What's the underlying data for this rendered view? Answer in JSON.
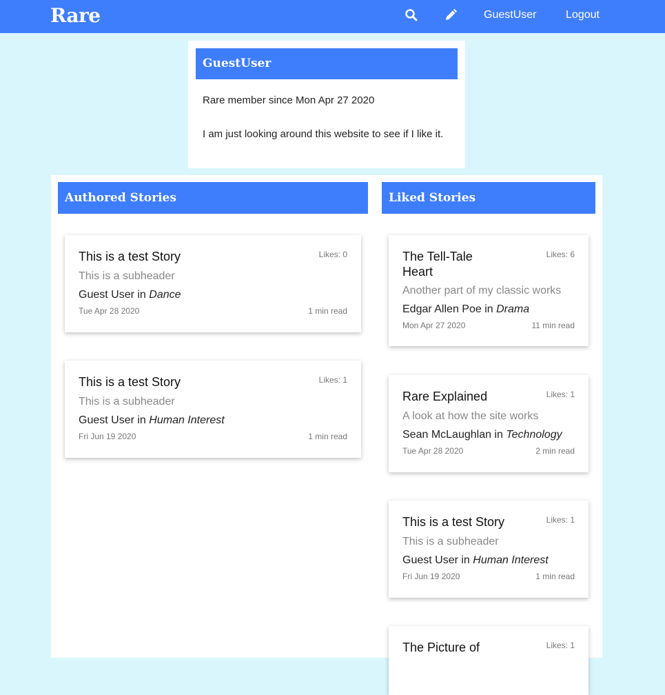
{
  "nav": {
    "brand": "Rare",
    "search_icon": "search-icon",
    "write_icon": "pencil-icon",
    "user_link": "GuestUser",
    "logout_link": "Logout",
    "color": "#3e7efc"
  },
  "profile": {
    "username": "GuestUser",
    "member_since": "Rare member since Mon Apr 27 2020",
    "bio": "I am just looking around this website to see if I like it."
  },
  "authored": {
    "heading": "Authored Stories",
    "stories": [
      {
        "title": "This is a test Story",
        "likes": "Likes: 0",
        "subheader": "This is a subheader",
        "author": "Guest User",
        "in_word": "in",
        "category": "Dance",
        "date": "Tue Apr 28 2020",
        "read": "1 min read"
      },
      {
        "title": "This is a test Story",
        "likes": "Likes: 1",
        "subheader": "This is a subheader",
        "author": "Guest User",
        "in_word": "in",
        "category": "Human Interest",
        "date": "Fri Jun 19 2020",
        "read": "1 min read"
      }
    ]
  },
  "liked": {
    "heading": "Liked Stories",
    "stories": [
      {
        "title": "The Tell-Tale Heart",
        "likes": "Likes: 6",
        "subheader": "Another part of my classic works",
        "author": "Edgar Allen Poe",
        "in_word": "in",
        "category": "Drama",
        "date": "Mon Apr 27 2020",
        "read": "11 min read"
      },
      {
        "title": "Rare Explained",
        "likes": "Likes: 1",
        "subheader": "A look at how the site works",
        "author": "Sean McLaughlan",
        "in_word": "in",
        "category": "Technology",
        "date": "Tue Apr 28 2020",
        "read": "2 min read"
      },
      {
        "title": "This is a test Story",
        "likes": "Likes: 1",
        "subheader": "This is a subheader",
        "author": "Guest User",
        "in_word": "in",
        "category": "Human Interest",
        "date": "Fri Jun 19 2020",
        "read": "1 min read"
      },
      {
        "title": "The Picture of",
        "likes": "Likes: 1"
      }
    ]
  }
}
